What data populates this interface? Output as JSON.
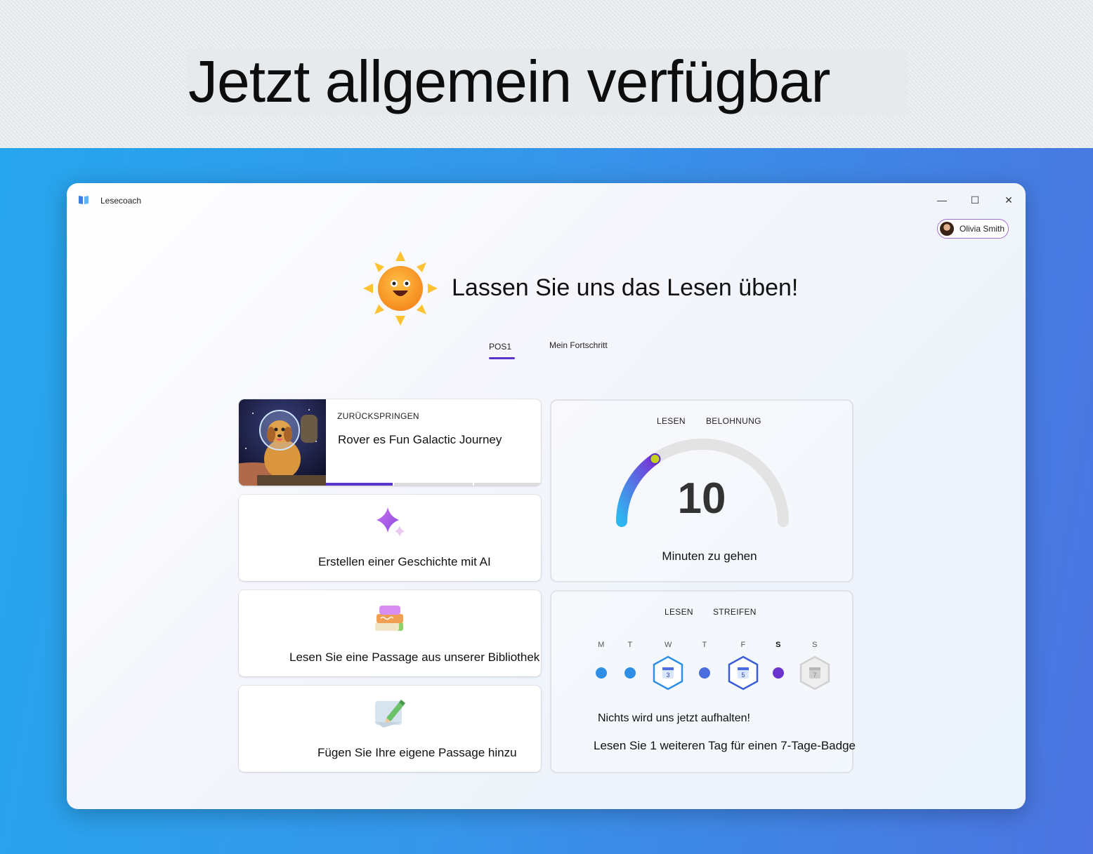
{
  "banner": {
    "headline": "Jetzt allgemein verfügbar"
  },
  "window": {
    "app_title": "Lesecoach",
    "controls": {
      "minimize": "—",
      "maximize": "☐",
      "close": "✕"
    },
    "user": {
      "name": "Olivia Smith"
    }
  },
  "hero": {
    "title": "Lassen Sie uns das Lesen üben!"
  },
  "tabs": [
    {
      "label": "POS1",
      "selected": true
    },
    {
      "label": "Mein Fortschritt",
      "selected": false
    }
  ],
  "continue_card": {
    "eyebrow": "ZURÜCKSPRINGEN",
    "title": "Rover es Fun Galactic Journey",
    "progress_segments": 3,
    "progress_done": 1
  },
  "actions": [
    {
      "label": "Erstellen einer Geschichte mit AI",
      "icon": "sparkle-icon"
    },
    {
      "label": "Lesen Sie eine Passage aus unserer Bibliothek",
      "icon": "books-icon"
    },
    {
      "label": "Fügen Sie Ihre eigene Passage hinzu",
      "icon": "pencil-note-icon"
    }
  ],
  "reward_card": {
    "label_left": "LESEN",
    "label_right": "BELOHNUNG",
    "value": "10",
    "progress_fraction": 0.3,
    "caption": "Minuten zu gehen"
  },
  "streak_card": {
    "label_left": "LESEN",
    "label_right": "STREIFEN",
    "days": [
      {
        "letter": "M",
        "state": "read"
      },
      {
        "letter": "T",
        "state": "read"
      },
      {
        "letter": "W",
        "state": "badge",
        "badge": "3"
      },
      {
        "letter": "T",
        "state": "read"
      },
      {
        "letter": "F",
        "state": "badge",
        "badge": "5"
      },
      {
        "letter": "S",
        "state": "today"
      },
      {
        "letter": "S",
        "state": "locked",
        "badge": "7"
      }
    ],
    "line1": "Nichts wird uns jetzt aufhalten!",
    "line2": "Lesen Sie 1 weiteren Tag für einen 7-Tage-Badge"
  },
  "colors": {
    "accent": "#5a36c8",
    "blue": "#2f8fe6",
    "backdrop_start": "#26a5ec",
    "backdrop_end": "#4c73e0"
  }
}
